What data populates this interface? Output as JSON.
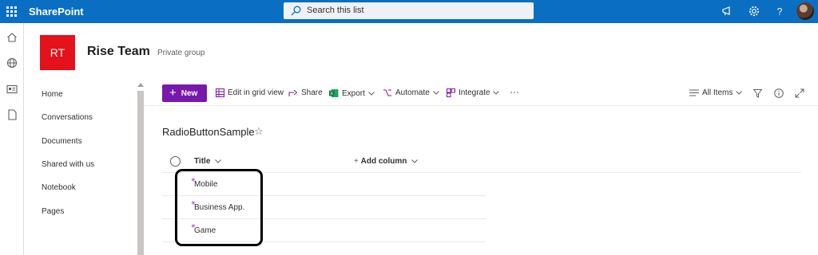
{
  "suite": {
    "app_name": "SharePoint",
    "search_placeholder": "Search this list",
    "icons": [
      "waffle-icon",
      "megaphone-icon",
      "gear-icon",
      "help-icon",
      "avatar"
    ]
  },
  "rail": {
    "icons": [
      "home-icon",
      "globe-icon",
      "news-icon",
      "document-icon"
    ]
  },
  "site": {
    "logo_initials": "RT",
    "logo_color": "#e3121b",
    "title": "Rise Team",
    "subtitle": "Private group"
  },
  "nav": {
    "items": [
      "Home",
      "Conversations",
      "Documents",
      "Shared with us",
      "Notebook",
      "Pages"
    ]
  },
  "commandbar": {
    "new_label": "New",
    "grid_view_label": "Edit in grid view",
    "share_label": "Share",
    "export_label": "Export",
    "automate_label": "Automate",
    "integrate_label": "Integrate",
    "more_label": "···",
    "view_label": "All Items"
  },
  "list": {
    "title": "RadioButtonSample",
    "columns": [
      "Title",
      "Add column"
    ],
    "rows": [
      "Mobile",
      "Business App.",
      "Game"
    ],
    "new_item_marker": "✳"
  },
  "colors": {
    "suite_bar": "#0a6fc2",
    "accent": "#7719aa",
    "logo": "#e3121b"
  }
}
